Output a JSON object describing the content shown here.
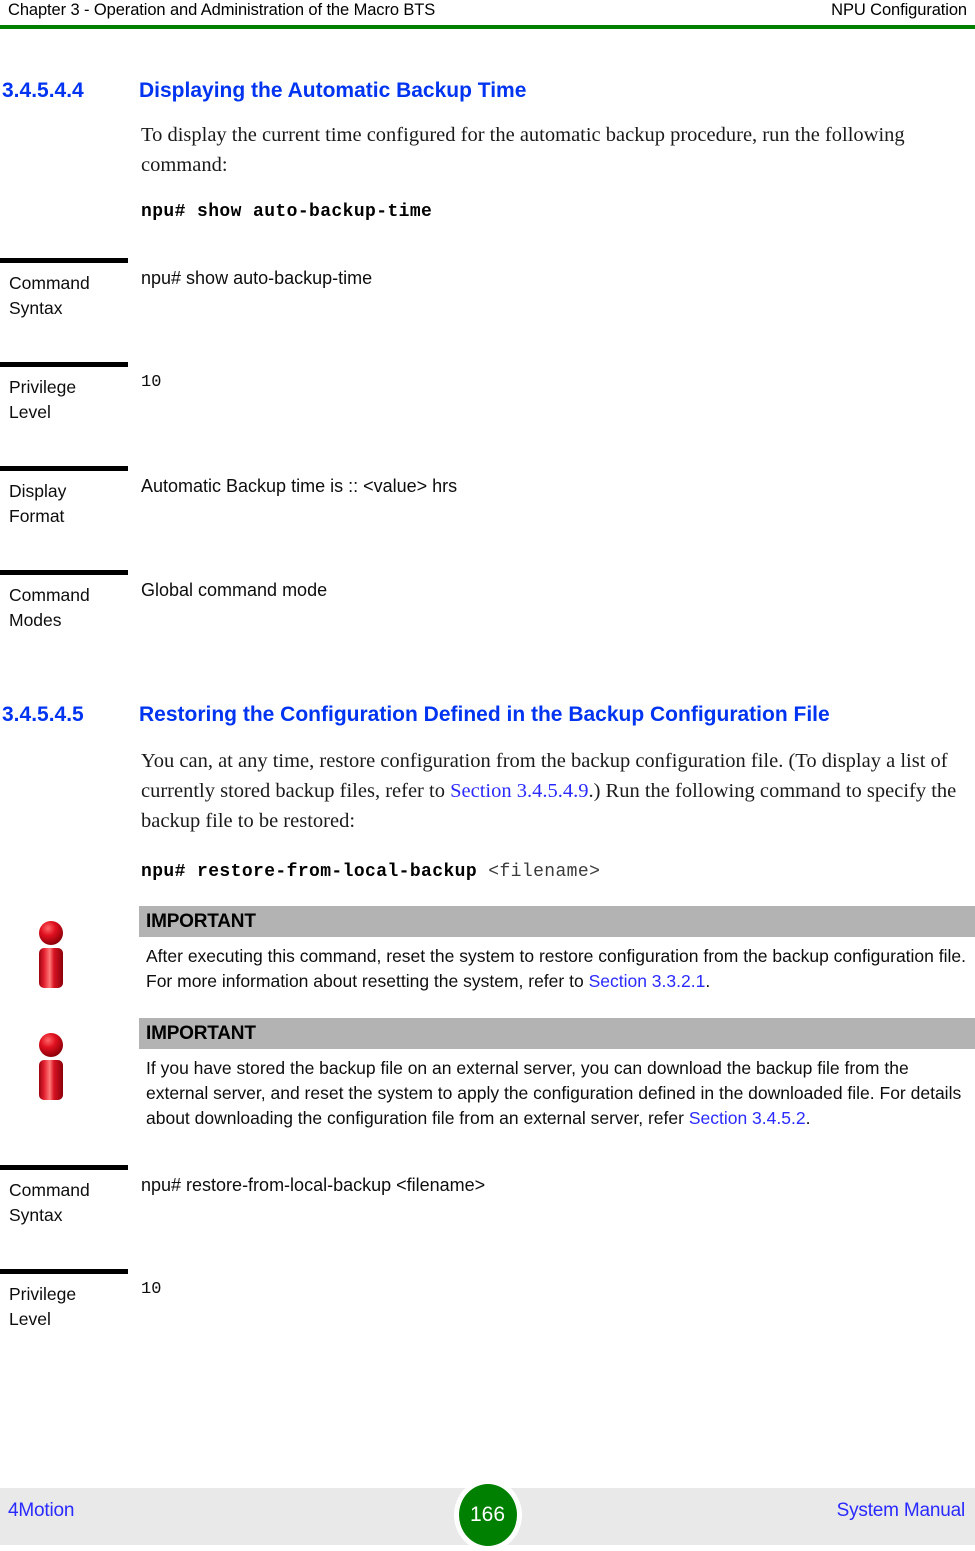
{
  "header": {
    "left": "Chapter 3 - Operation and Administration of the Macro BTS",
    "right": "NPU Configuration",
    "rule_color": "#008000"
  },
  "sections": [
    {
      "number": "3.4.5.4.4",
      "title": "Displaying the Automatic Backup Time",
      "paragraph": "To display the current time configured for the automatic backup procedure, run the following command:",
      "command": {
        "cmd": "npu# show auto-backup-time",
        "arg": ""
      },
      "table": [
        {
          "label": "Command Syntax",
          "value": "npu# show auto-backup-time",
          "mono": false
        },
        {
          "label": "Privilege Level",
          "value": "10",
          "mono": true
        },
        {
          "label": "Display Format",
          "value": "Automatic Backup time is :: <value> hrs",
          "mono": false
        },
        {
          "label": "Command Modes",
          "value": "Global command mode",
          "mono": false
        }
      ]
    },
    {
      "number": "3.4.5.4.5",
      "title": "Restoring the Configuration Defined in the Backup Configuration File",
      "paragraph_part1": "You can, at any time, restore configuration from the backup configuration file. (To display a list of currently stored backup files, refer to ",
      "paragraph_link": "Section 3.4.5.4.9",
      "paragraph_part2": ".) Run the following command to specify the backup file to be restored:",
      "command": {
        "cmd": "npu# restore-from-local-backup",
        "arg": "<filename>"
      },
      "table": [
        {
          "label": "Command Syntax",
          "value": "npu# restore-from-local-backup <filename>",
          "mono": false
        },
        {
          "label": "Privilege Level",
          "value": "10",
          "mono": true
        }
      ]
    }
  ],
  "notices": [
    {
      "title": "IMPORTANT",
      "text_part1": "After executing this command, reset the system to restore configuration from the backup configuration file. For more information about resetting the system, refer to ",
      "link": "Section 3.3.2.1",
      "text_part2": ".",
      "icon": "info-icon",
      "bar_color": "#b3b3b3"
    },
    {
      "title": "IMPORTANT",
      "text_part1": "If you have stored the backup file on an external server, you can download the backup file from the external server, and reset the system to apply the configuration defined in the downloaded file. For details about downloading the configuration file from an external server, refer ",
      "link": "Section 3.4.5.2",
      "text_part2": ".",
      "icon": "info-icon",
      "bar_color": "#b3b3b3"
    }
  ],
  "footer": {
    "left": "4Motion",
    "page_number": "166",
    "right": "System Manual",
    "badge_color": "#008000",
    "link_color": "#2a2aff"
  }
}
